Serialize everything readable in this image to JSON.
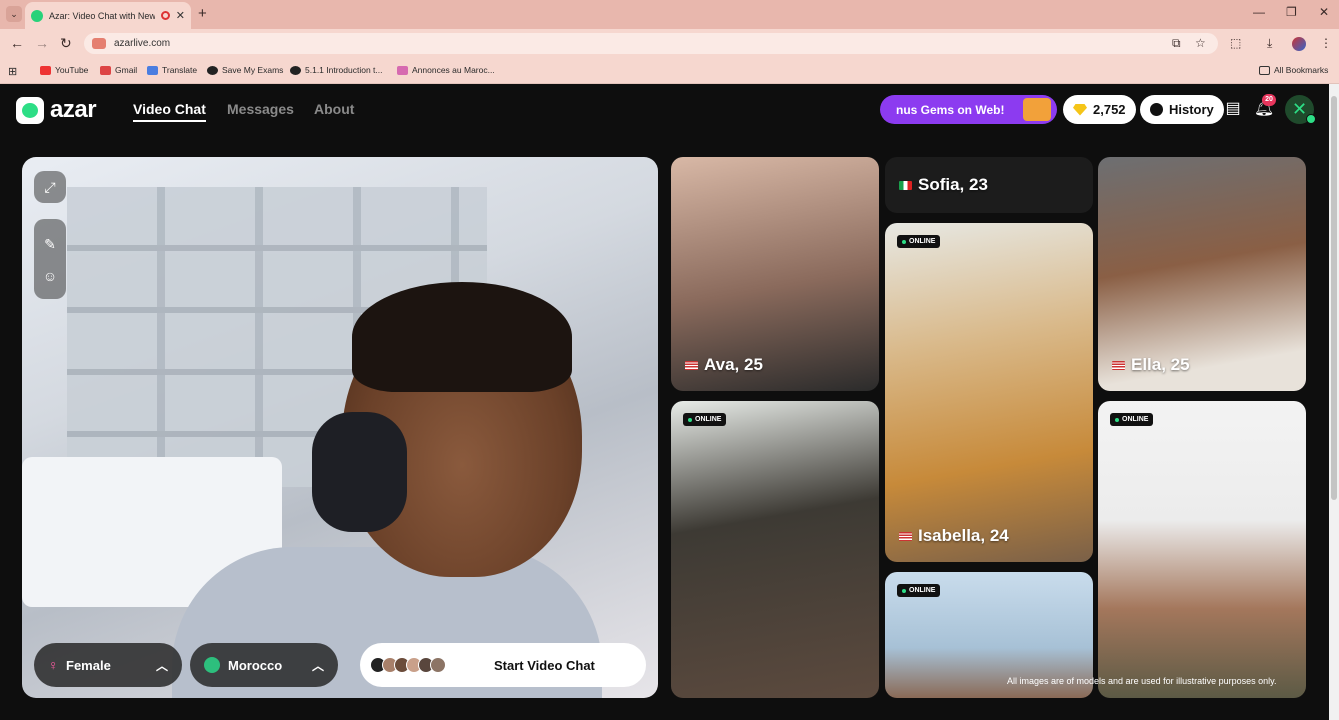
{
  "browser": {
    "tab_title": "Azar: Video Chat with New",
    "url": "azarlive.com",
    "bookmarks": [
      "YouTube",
      "Gmail",
      "Translate",
      "Save My Exams",
      "5.1.1 Introduction t...",
      "Annonces au Maroc..."
    ],
    "all_bookmarks": "All Bookmarks"
  },
  "app": {
    "logo": "azar",
    "nav": [
      "Video Chat",
      "Messages",
      "About"
    ],
    "promo": "nus Gems on Web!",
    "gems": "2,752",
    "history": "History",
    "notifications": "20"
  },
  "video": {
    "gender": "Female",
    "country": "Morocco",
    "start": "Start Video Chat"
  },
  "cards": {
    "ava": "Ava, 25",
    "sofia": "Sofia, 23",
    "ella": "Ella, 25",
    "isabella": "Isabella, 24",
    "online": "ONLINE"
  },
  "disclaimer": "All images are of models and are used for illustrative purposes only.",
  "colors": {
    "accent_green": "#2dde86",
    "promo_purple": "#8c3bf0",
    "browser_pink": "#f6d7cf"
  }
}
